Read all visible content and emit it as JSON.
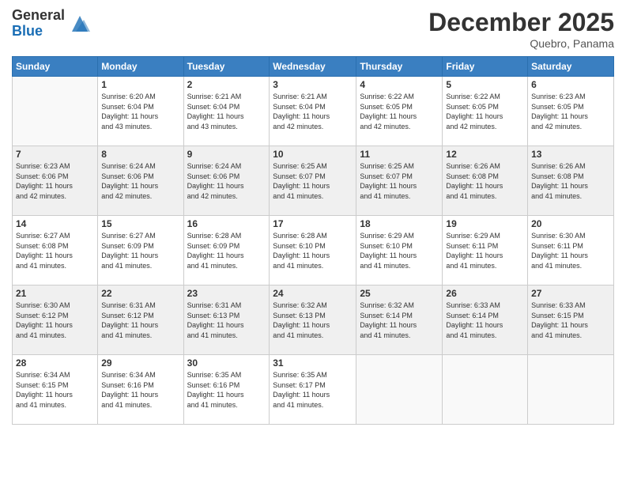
{
  "logo": {
    "general": "General",
    "blue": "Blue"
  },
  "title": "December 2025",
  "location": "Quebro, Panama",
  "days_header": [
    "Sunday",
    "Monday",
    "Tuesday",
    "Wednesday",
    "Thursday",
    "Friday",
    "Saturday"
  ],
  "weeks": [
    [
      {
        "num": "",
        "info": ""
      },
      {
        "num": "1",
        "info": "Sunrise: 6:20 AM\nSunset: 6:04 PM\nDaylight: 11 hours\nand 43 minutes."
      },
      {
        "num": "2",
        "info": "Sunrise: 6:21 AM\nSunset: 6:04 PM\nDaylight: 11 hours\nand 43 minutes."
      },
      {
        "num": "3",
        "info": "Sunrise: 6:21 AM\nSunset: 6:04 PM\nDaylight: 11 hours\nand 42 minutes."
      },
      {
        "num": "4",
        "info": "Sunrise: 6:22 AM\nSunset: 6:05 PM\nDaylight: 11 hours\nand 42 minutes."
      },
      {
        "num": "5",
        "info": "Sunrise: 6:22 AM\nSunset: 6:05 PM\nDaylight: 11 hours\nand 42 minutes."
      },
      {
        "num": "6",
        "info": "Sunrise: 6:23 AM\nSunset: 6:05 PM\nDaylight: 11 hours\nand 42 minutes."
      }
    ],
    [
      {
        "num": "7",
        "info": "Sunrise: 6:23 AM\nSunset: 6:06 PM\nDaylight: 11 hours\nand 42 minutes."
      },
      {
        "num": "8",
        "info": "Sunrise: 6:24 AM\nSunset: 6:06 PM\nDaylight: 11 hours\nand 42 minutes."
      },
      {
        "num": "9",
        "info": "Sunrise: 6:24 AM\nSunset: 6:06 PM\nDaylight: 11 hours\nand 42 minutes."
      },
      {
        "num": "10",
        "info": "Sunrise: 6:25 AM\nSunset: 6:07 PM\nDaylight: 11 hours\nand 41 minutes."
      },
      {
        "num": "11",
        "info": "Sunrise: 6:25 AM\nSunset: 6:07 PM\nDaylight: 11 hours\nand 41 minutes."
      },
      {
        "num": "12",
        "info": "Sunrise: 6:26 AM\nSunset: 6:08 PM\nDaylight: 11 hours\nand 41 minutes."
      },
      {
        "num": "13",
        "info": "Sunrise: 6:26 AM\nSunset: 6:08 PM\nDaylight: 11 hours\nand 41 minutes."
      }
    ],
    [
      {
        "num": "14",
        "info": "Sunrise: 6:27 AM\nSunset: 6:08 PM\nDaylight: 11 hours\nand 41 minutes."
      },
      {
        "num": "15",
        "info": "Sunrise: 6:27 AM\nSunset: 6:09 PM\nDaylight: 11 hours\nand 41 minutes."
      },
      {
        "num": "16",
        "info": "Sunrise: 6:28 AM\nSunset: 6:09 PM\nDaylight: 11 hours\nand 41 minutes."
      },
      {
        "num": "17",
        "info": "Sunrise: 6:28 AM\nSunset: 6:10 PM\nDaylight: 11 hours\nand 41 minutes."
      },
      {
        "num": "18",
        "info": "Sunrise: 6:29 AM\nSunset: 6:10 PM\nDaylight: 11 hours\nand 41 minutes."
      },
      {
        "num": "19",
        "info": "Sunrise: 6:29 AM\nSunset: 6:11 PM\nDaylight: 11 hours\nand 41 minutes."
      },
      {
        "num": "20",
        "info": "Sunrise: 6:30 AM\nSunset: 6:11 PM\nDaylight: 11 hours\nand 41 minutes."
      }
    ],
    [
      {
        "num": "21",
        "info": "Sunrise: 6:30 AM\nSunset: 6:12 PM\nDaylight: 11 hours\nand 41 minutes."
      },
      {
        "num": "22",
        "info": "Sunrise: 6:31 AM\nSunset: 6:12 PM\nDaylight: 11 hours\nand 41 minutes."
      },
      {
        "num": "23",
        "info": "Sunrise: 6:31 AM\nSunset: 6:13 PM\nDaylight: 11 hours\nand 41 minutes."
      },
      {
        "num": "24",
        "info": "Sunrise: 6:32 AM\nSunset: 6:13 PM\nDaylight: 11 hours\nand 41 minutes."
      },
      {
        "num": "25",
        "info": "Sunrise: 6:32 AM\nSunset: 6:14 PM\nDaylight: 11 hours\nand 41 minutes."
      },
      {
        "num": "26",
        "info": "Sunrise: 6:33 AM\nSunset: 6:14 PM\nDaylight: 11 hours\nand 41 minutes."
      },
      {
        "num": "27",
        "info": "Sunrise: 6:33 AM\nSunset: 6:15 PM\nDaylight: 11 hours\nand 41 minutes."
      }
    ],
    [
      {
        "num": "28",
        "info": "Sunrise: 6:34 AM\nSunset: 6:15 PM\nDaylight: 11 hours\nand 41 minutes."
      },
      {
        "num": "29",
        "info": "Sunrise: 6:34 AM\nSunset: 6:16 PM\nDaylight: 11 hours\nand 41 minutes."
      },
      {
        "num": "30",
        "info": "Sunrise: 6:35 AM\nSunset: 6:16 PM\nDaylight: 11 hours\nand 41 minutes."
      },
      {
        "num": "31",
        "info": "Sunrise: 6:35 AM\nSunset: 6:17 PM\nDaylight: 11 hours\nand 41 minutes."
      },
      {
        "num": "",
        "info": ""
      },
      {
        "num": "",
        "info": ""
      },
      {
        "num": "",
        "info": ""
      }
    ]
  ]
}
